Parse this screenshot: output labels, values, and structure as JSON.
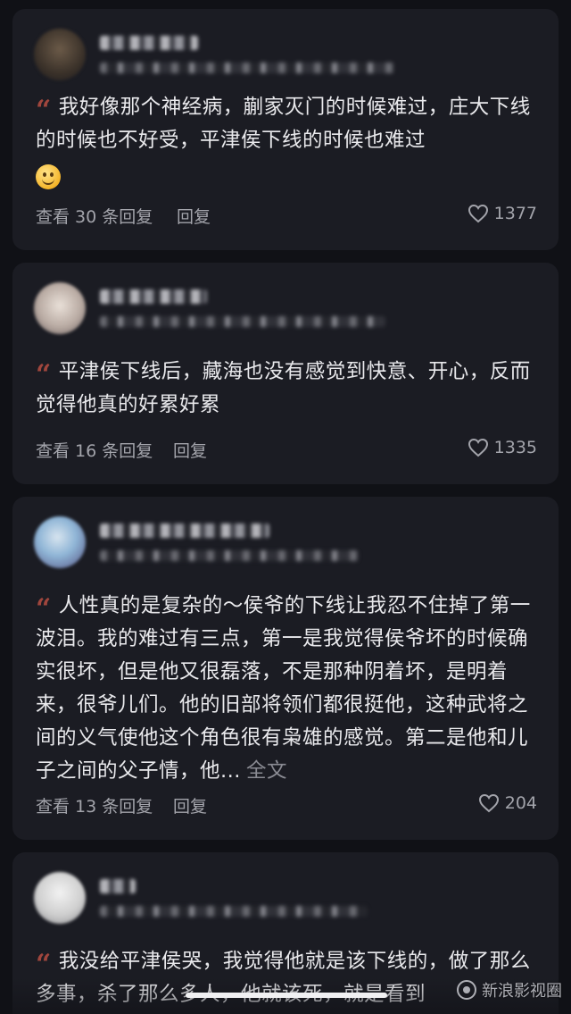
{
  "comments": [
    {
      "text": "我好像那个神经病，蒯家灭门的时候难过，庄大下线的时候也不好受，平津侯下线的时候也难过",
      "emoji": "smiling-face",
      "view_replies": "查看 30 条回复",
      "reply": "回复",
      "likes": "1377"
    },
    {
      "text": "平津侯下线后，藏海也没有感觉到快意、开心，反而觉得他真的好累好累",
      "view_replies": "查看 16 条回复",
      "reply": "回复",
      "likes": "1335"
    },
    {
      "text": "人性真的是复杂的～侯爷的下线让我忍不住掉了第一波泪。我的难过有三点，第一是我觉得侯爷坏的时候确实很坏，但是他又很磊落，不是那种阴着坏，是明着来，很爷儿们。他的旧部将领们都很挺他，这种武将之间的义气使他这个角色很有枭雄的感觉。第二是他和儿子之间的父子情，他...",
      "more": "全文",
      "view_replies": "查看 13 条回复",
      "reply": "回复",
      "likes": "204"
    },
    {
      "text": "我没给平津侯哭，我觉得他就是该下线的，做了那么多事，杀了那么多人，他就该死，就是看到"
    }
  ],
  "watermark": "新浪影视圈",
  "colors": {
    "background": "#101116",
    "card": "#1b1c23",
    "quote_accent": "#a0463d",
    "secondary_text": "#a3a4ab"
  }
}
